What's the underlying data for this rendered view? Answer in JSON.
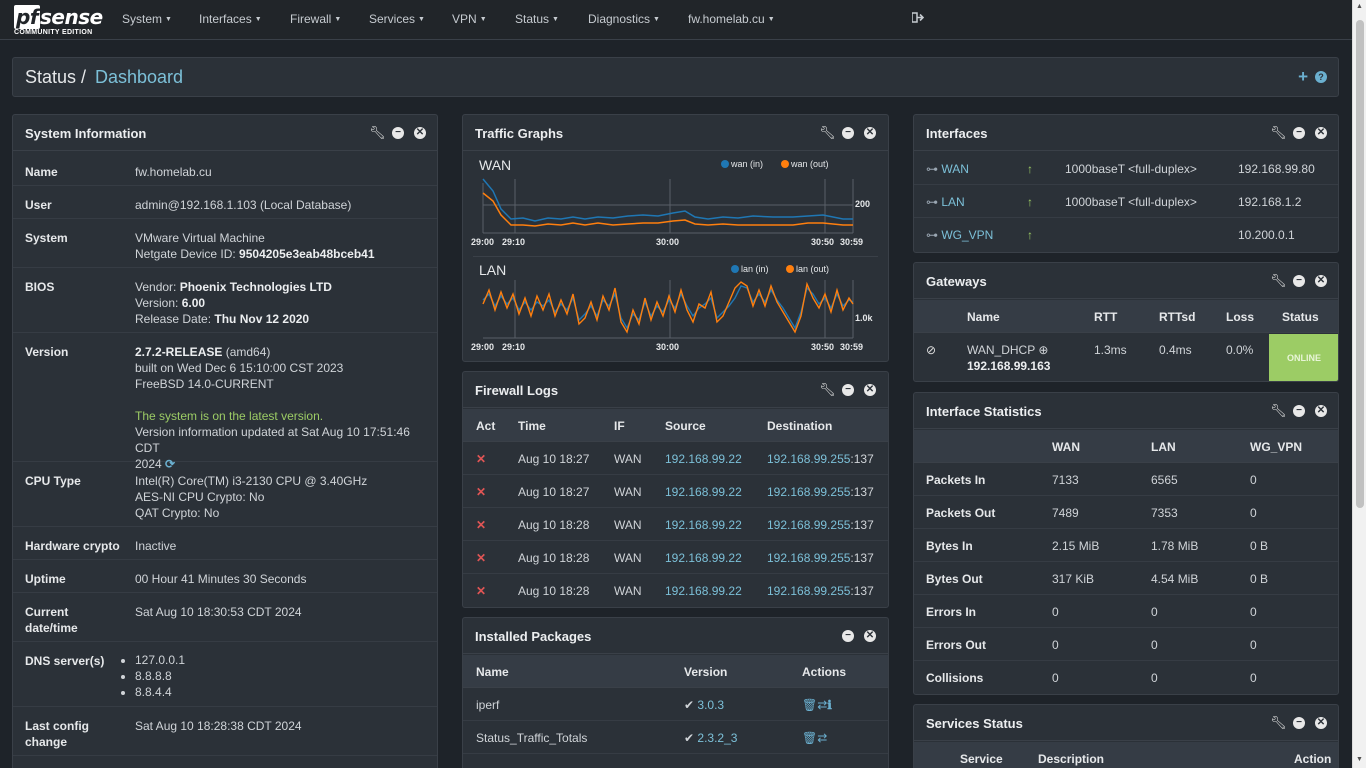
{
  "nav": {
    "brand_logo": "pfsense",
    "brand_sub": "COMMUNITY EDITION",
    "items": [
      "System",
      "Interfaces",
      "Firewall",
      "Services",
      "VPN",
      "Status",
      "Diagnostics",
      "fw.homelab.cu"
    ]
  },
  "breadcrumb": {
    "section": "Status",
    "sep": "/",
    "page": "Dashboard"
  },
  "sysinfo": {
    "title": "System Information",
    "name_label": "Name",
    "name": "fw.homelab.cu",
    "user_label": "User",
    "user": "admin@192.168.1.103 (Local Database)",
    "system_label": "System",
    "system_line1": "VMware Virtual Machine",
    "system_line2_prefix": "Netgate Device ID: ",
    "system_line2_id": "9504205e3eab48bceb41",
    "bios_label": "BIOS",
    "bios_vendor_prefix": "Vendor: ",
    "bios_vendor": "Phoenix Technologies LTD",
    "bios_version_prefix": "Version: ",
    "bios_version": "6.00",
    "bios_date_prefix": "Release Date: ",
    "bios_date": "Thu Nov 12 2020",
    "version_label": "Version",
    "version": "2.7.2-RELEASE",
    "version_arch": " (amd64)",
    "version_built": "built on Wed Dec 6 15:10:00 CST 2023",
    "version_os": "FreeBSD 14.0-CURRENT",
    "version_status": "The system is on the latest version.",
    "version_updated_1": "Version information updated at Sat Aug 10 17:51:46 CDT",
    "version_updated_2": "2024",
    "cpu_label": "CPU Type",
    "cpu_line1": "Intel(R) Core(TM) i3-2130 CPU @ 3.40GHz",
    "cpu_line2": "AES-NI CPU Crypto: No",
    "cpu_line3": "QAT Crypto: No",
    "hwcrypto_label": "Hardware crypto",
    "hwcrypto": "Inactive",
    "uptime_label": "Uptime",
    "uptime": "00 Hour 41 Minutes 30 Seconds",
    "datetime_label_1": "Current",
    "datetime_label_2": "date/time",
    "datetime": "Sat Aug 10 18:30:53 CDT 2024",
    "dns_label": "DNS server(s)",
    "dns": [
      "127.0.0.1",
      "8.8.8.8",
      "8.8.4.4"
    ],
    "lastconfig_label_1": "Last config",
    "lastconfig_label_2": "change",
    "lastconfig": "Sat Aug 10 18:28:38 CDT 2024"
  },
  "traffic": {
    "title": "Traffic Graphs",
    "wan": {
      "title": "WAN",
      "legend_in": "wan (in)",
      "legend_out": "wan (out)",
      "ylabel": "200",
      "x_ticks": [
        "29:00",
        "29:10",
        "30:00",
        "30:50",
        "30:59"
      ]
    },
    "lan": {
      "title": "LAN",
      "legend_in": "lan (in)",
      "legend_out": "lan (out)",
      "ylabel": "1.0k",
      "x_ticks": [
        "29:00",
        "29:10",
        "30:00",
        "30:50",
        "30:59"
      ]
    },
    "colors": {
      "in": "#1f77b4",
      "out": "#ff7f0e"
    }
  },
  "fwlogs": {
    "title": "Firewall Logs",
    "headers": [
      "Act",
      "Time",
      "IF",
      "Source",
      "Destination"
    ],
    "rows": [
      {
        "time": "Aug 10 18:27",
        "if": "WAN",
        "src": "192.168.99.22",
        "dst": "192.168.99.255",
        "port": ":137"
      },
      {
        "time": "Aug 10 18:27",
        "if": "WAN",
        "src": "192.168.99.22",
        "dst": "192.168.99.255",
        "port": ":137"
      },
      {
        "time": "Aug 10 18:28",
        "if": "WAN",
        "src": "192.168.99.22",
        "dst": "192.168.99.255",
        "port": ":137"
      },
      {
        "time": "Aug 10 18:28",
        "if": "WAN",
        "src": "192.168.99.22",
        "dst": "192.168.99.255",
        "port": ":137"
      },
      {
        "time": "Aug 10 18:28",
        "if": "WAN",
        "src": "192.168.99.22",
        "dst": "192.168.99.255",
        "port": ":137"
      }
    ]
  },
  "packages": {
    "title": "Installed Packages",
    "headers": [
      "Name",
      "Version",
      "Actions"
    ],
    "rows": [
      {
        "name": "iperf",
        "version": "3.0.3"
      },
      {
        "name": "Status_Traffic_Totals",
        "version": "2.3.2_3"
      }
    ]
  },
  "interfaces": {
    "title": "Interfaces",
    "rows": [
      {
        "name": "WAN",
        "media": "1000baseT <full-duplex>",
        "ip": "192.168.99.80"
      },
      {
        "name": "LAN",
        "media": "1000baseT <full-duplex>",
        "ip": "192.168.1.2"
      },
      {
        "name": "WG_VPN",
        "media": "",
        "ip": "10.200.0.1"
      }
    ]
  },
  "gateways": {
    "title": "Gateways",
    "headers": [
      "Name",
      "RTT",
      "RTTsd",
      "Loss",
      "Status"
    ],
    "row": {
      "name": "WAN_DHCP",
      "ip": "192.168.99.163",
      "rtt": "1.3ms",
      "rttsd": "0.4ms",
      "loss": "0.0%",
      "status": "ONLINE"
    }
  },
  "ifstats": {
    "title": "Interface Statistics",
    "headers": [
      "WAN",
      "LAN",
      "WG_VPN"
    ],
    "rows": [
      {
        "label": "Packets In",
        "wan": "7133",
        "lan": "6565",
        "vpn": "0"
      },
      {
        "label": "Packets Out",
        "wan": "7489",
        "lan": "7353",
        "vpn": "0"
      },
      {
        "label": "Bytes In",
        "wan": "2.15 MiB",
        "lan": "1.78 MiB",
        "vpn": "0 B"
      },
      {
        "label": "Bytes Out",
        "wan": "317 KiB",
        "lan": "4.54 MiB",
        "vpn": "0 B"
      },
      {
        "label": "Errors In",
        "wan": "0",
        "lan": "0",
        "vpn": "0"
      },
      {
        "label": "Errors Out",
        "wan": "0",
        "lan": "0",
        "vpn": "0"
      },
      {
        "label": "Collisions",
        "wan": "0",
        "lan": "0",
        "vpn": "0"
      }
    ]
  },
  "services": {
    "title": "Services Status",
    "headers": [
      "Service",
      "Description",
      "Action"
    ]
  }
}
